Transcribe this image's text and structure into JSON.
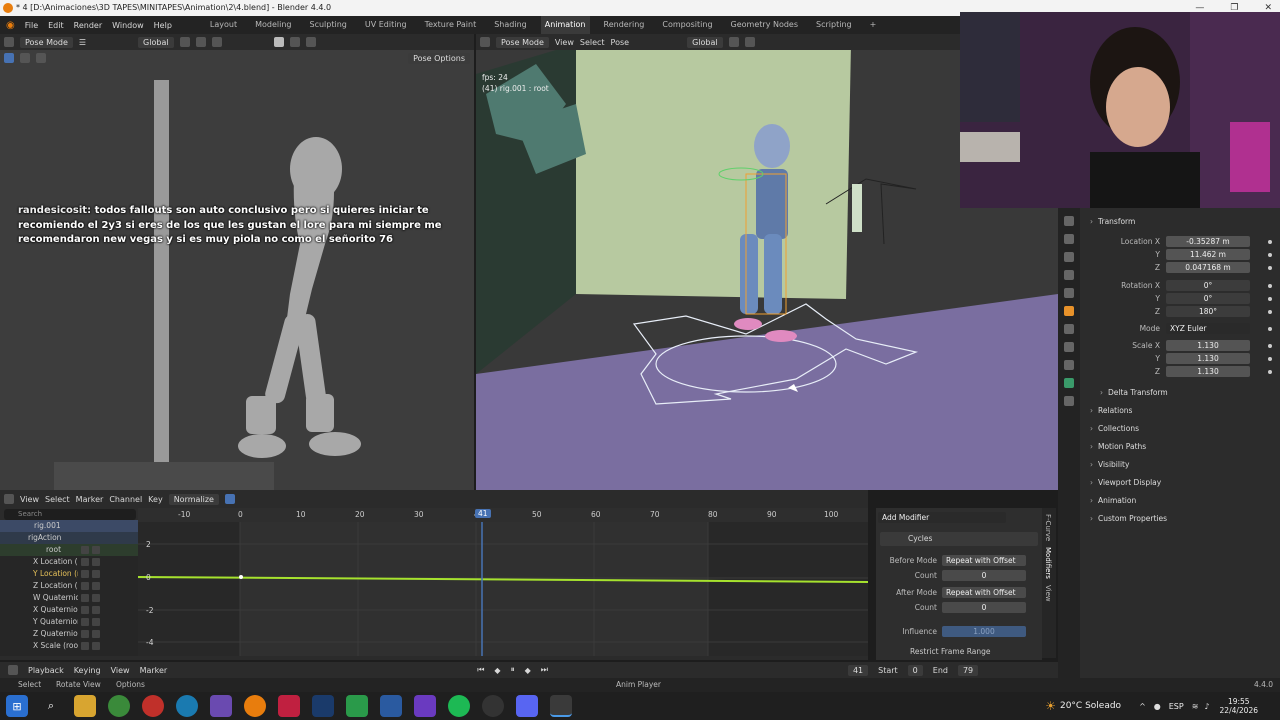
{
  "title": "* 4 [D:\\Animaciones\\3D TAPES\\MINITAPES\\Animation\\2\\4.blend] - Blender 4.4.0",
  "menu": [
    "File",
    "Edit",
    "Render",
    "Window",
    "Help"
  ],
  "workspaces": [
    "Layout",
    "Modeling",
    "Sculpting",
    "UV Editing",
    "Texture Paint",
    "Shading",
    "Animation",
    "Rendering",
    "Compositing",
    "Geometry Nodes",
    "Scripting",
    "+"
  ],
  "active_workspace": "Animation",
  "left_viewport": {
    "mode": "Pose Mode",
    "orientation": "Global",
    "pose_options": "Pose Options"
  },
  "right_viewport": {
    "mode": "Pose Mode",
    "menus": [
      "View",
      "Select",
      "Pose"
    ],
    "orientation": "Global",
    "overlay_text": [
      "fps: 24",
      "(41) rig.001 : root"
    ]
  },
  "chat": {
    "user": "randesicosit:",
    "message": "todos fallouts son auto conclusivo pero si quieres iniciar te recomiendo el 2y3 si eres de los que les gustan el lore para mi siempre me recomendaron new vegas y si es muy piola no como el señorito 76"
  },
  "properties": {
    "section": "Transform",
    "location": {
      "label": "Location X",
      "x": "-0.35287 m",
      "y": "11.462 m",
      "z": "0.047168 m"
    },
    "rotation": {
      "label": "Rotation X",
      "x": "0°",
      "y": "0°",
      "z": "180°"
    },
    "mode_label": "Mode",
    "mode_value": "XYZ Euler",
    "scale": {
      "label": "Scale X",
      "x": "1.130",
      "y": "1.130",
      "z": "1.130"
    },
    "axis_y": "Y",
    "axis_z": "Z",
    "delta": "Delta Transform",
    "panels": [
      "Relations",
      "Collections",
      "Motion Paths",
      "Visibility",
      "Viewport Display",
      "Animation",
      "Custom Properties"
    ]
  },
  "graph_editor": {
    "menus": [
      "View",
      "Select",
      "Marker",
      "Channel",
      "Key"
    ],
    "normalize": "Normalize",
    "search_placeholder": "Search",
    "ruler": [
      "-10",
      "0",
      "10",
      "20",
      "30",
      "40",
      "50",
      "60",
      "70",
      "80",
      "90",
      "100"
    ],
    "current_frame": "41",
    "y_ticks": [
      "2",
      "0",
      "-2",
      "-4"
    ],
    "channels": [
      {
        "name": "rig.001"
      },
      {
        "name": "rigAction"
      },
      {
        "name": "root"
      },
      {
        "name": "X Location (root)"
      },
      {
        "name": "Y Location (root)"
      },
      {
        "name": "Z Location (root)"
      },
      {
        "name": "W Quaternion Rota"
      },
      {
        "name": "X Quaternion Rota"
      },
      {
        "name": "Y Quaternion Rota"
      },
      {
        "name": "Z Quaternion Rota"
      },
      {
        "name": "X Scale (root)"
      }
    ]
  },
  "modifiers": {
    "add": "Add Modifier",
    "name": "Cycles",
    "before_mode_label": "Before Mode",
    "before_mode": "Repeat with Offset",
    "count_label": "Count",
    "count": "0",
    "after_mode_label": "After Mode",
    "after_mode": "Repeat with Offset",
    "influence_label": "Influence",
    "influence": "1.000",
    "restrict": "Restrict Frame Range",
    "tabs": [
      "F-Curve",
      "Modifiers",
      "View"
    ]
  },
  "timeline": {
    "menus": [
      "Playback",
      "Keying",
      "View",
      "Marker"
    ],
    "frame": "41",
    "start_label": "Start",
    "start": "0",
    "end_label": "End",
    "end": "79"
  },
  "status": {
    "items": [
      "Select",
      "Rotate View",
      "Options"
    ],
    "center": "Anim Player",
    "version": "4.4.0"
  },
  "taskbar": {
    "weather": "20°C Soleado",
    "lang": "ESP",
    "time": "19:55",
    "date": "22/4/2026"
  }
}
